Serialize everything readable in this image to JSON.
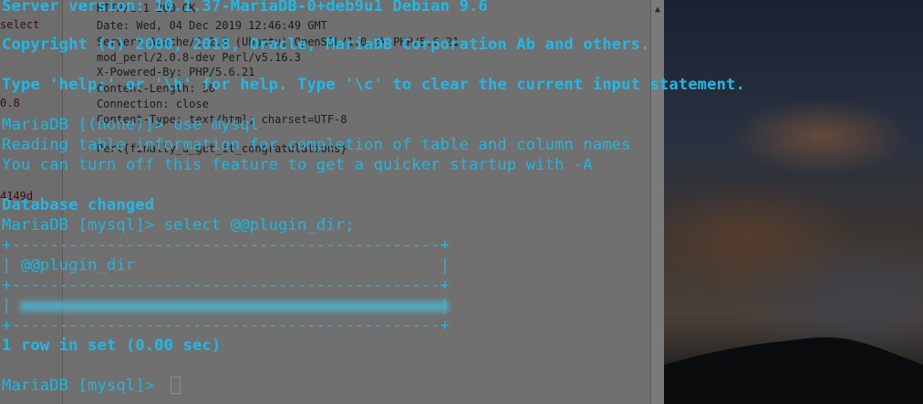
{
  "editor": {
    "sidebar_lines": [
      "select",
      "0.8",
      "4149d"
    ],
    "lines": [
      "HTTP/1.1 200 OK",
      "Date: Wed, 04 Dec 2019 12:46:49 GMT",
      "Server: Apache/2.2.8 (Ubuntu) OpenSSL/1.0.2k PHP/5.6.21",
      "mod_perl/2.0.8-dev Perl/v5.16.3",
      "X-Powered-By: PHP/5.6.21",
      "Content-Length: 30",
      "Connection: close",
      "Content-Type: text/html; charset=UTF-8",
      "",
      "Perl{finally_u_get_it_congratulations}"
    ]
  },
  "terminal": {
    "lines": {
      "server_version": "Server version: 10.1.37-MariaDB-0+deb9u1 Debian 9.6",
      "copyright": "Copyright (c) 2000, 2018, Oracle, MariaDB Corporation Ab and others.",
      "help": "Type 'help;' or '\\h' for help. Type '\\c' to clear the current input statement.",
      "prompt_use": "MariaDB [(none)]> use mysql",
      "reading": "Reading table information for completion of table and column names",
      "turn_off": "You can turn off this feature to get a quicker startup with -A",
      "db_changed": "Database changed",
      "prompt_select": "MariaDB [mysql]> select @@plugin_dir;",
      "table_border_top": "+---------------------------------------------+",
      "table_header": "| @@plugin_dir                                |",
      "table_border_mid": "+---------------------------------------------+",
      "table_row": "|                                             |",
      "table_border_bottom": "+---------------------------------------------+",
      "row_count": "1 row in set (0.00 sec)",
      "prompt_final": "MariaDB [mysql]> "
    }
  },
  "colors": {
    "terminal_text": "#1fb6e0",
    "editor_bg": "#707070"
  }
}
